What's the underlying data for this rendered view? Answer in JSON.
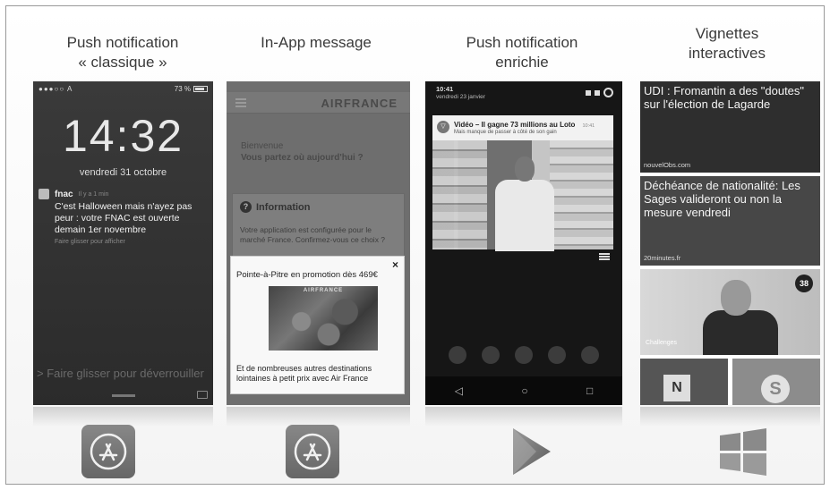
{
  "columns": [
    {
      "title_line1": "Push notification",
      "title_line2": "« classique »"
    },
    {
      "title_line1": "In-App message",
      "title_line2": ""
    },
    {
      "title_line1": "Push notification",
      "title_line2": "enrichie"
    },
    {
      "title_line1": "Vignettes",
      "title_line2": "interactives"
    }
  ],
  "lockscreen": {
    "status_left": "●●●○○ A ",
    "status_right": "73 %",
    "time": "14:32",
    "date": "vendredi 31 octobre",
    "app_name": "fnac",
    "app_time": "Il y a 1 min",
    "message": "C'est Halloween mais n'ayez pas peur : votre FNAC est ouverte demain 1er novembre",
    "hint": "Faire glisser pour afficher",
    "unlock": "> Faire glisser pour déverrouiller"
  },
  "inapp": {
    "brand": "AIRFRANCE",
    "welcome": "Bienvenue",
    "question": "Vous partez où aujourd'hui ?",
    "info_title": "Information",
    "info_text": "Votre application est configurée pour le marché France. Confirmez-vous ce choix ?",
    "close": "×",
    "promo": "Pointe-à-Pitre en promotion dès 469€",
    "image_brand": "AIRFRANCE",
    "bottom_text": "Et de nombreuses autres destinations lointaines à petit prix avec Air France"
  },
  "richpush": {
    "time": "10:41",
    "date": "vendredi 23 janvier",
    "title": "Vidéo – Il gagne 73 millions au Loto",
    "title_time": "10:41",
    "subtitle": "Mais manque de passer à côté de son gain",
    "nav_back": "◁",
    "nav_home": "○",
    "nav_recent": "□"
  },
  "tiles": {
    "t1_text": "UDI : Fromantin a des \"doutes\" sur l'élection de Lagarde",
    "t1_source": "nouvelObs.com",
    "t2_text": "Déchéance de nationalité: Les Sages valideront ou non la mesure vendredi",
    "t2_source": "20minutes.fr",
    "t3_source": "Challenges",
    "t3_badge": "38",
    "t4_icon": "N",
    "t5_icon": "S"
  },
  "stores": [
    "app-store-icon",
    "app-store-icon",
    "google-play-icon",
    "windows-store-icon"
  ]
}
